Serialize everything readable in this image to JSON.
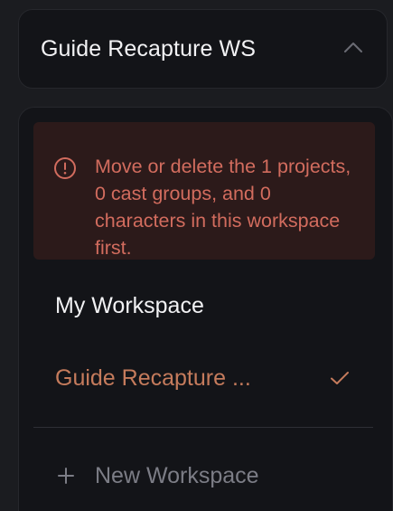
{
  "workspace_selector": {
    "current": "Guide Recapture WS",
    "toggle_icon": "chevron-up-icon"
  },
  "dropdown": {
    "warning": {
      "icon": "alert-circle-icon",
      "message": "Move or delete the 1 projects, 0 cast groups, and 0 characters in this workspace first."
    },
    "items": [
      {
        "label": "My Workspace",
        "selected": false
      },
      {
        "label": "Guide Recapture ...",
        "selected": true,
        "icon": "checkmark-icon"
      }
    ],
    "new_workspace": {
      "icon": "plus-icon",
      "label": "New Workspace"
    }
  },
  "colors": {
    "background": "#1b1c20",
    "card": "#131418",
    "warning_bg": "#2c1a1a",
    "warning_text": "#d26c5e",
    "accent": "#c57b5c",
    "muted_text": "#7c7d86",
    "primary_text": "#f2f2f4"
  }
}
